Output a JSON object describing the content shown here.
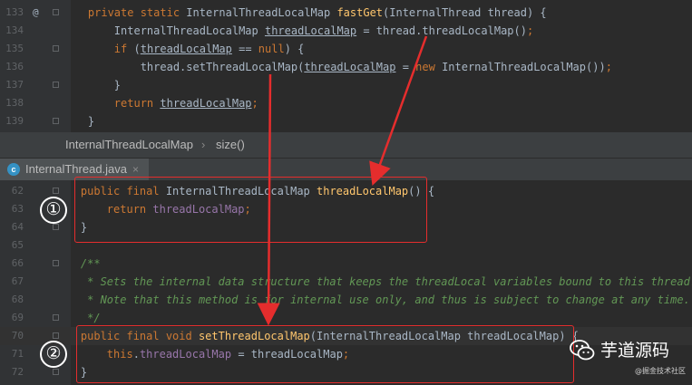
{
  "top_editor": {
    "lines": [
      {
        "num": "133",
        "at": "@",
        "segments": [
          {
            "t": "    ",
            "c": ""
          },
          {
            "t": "private static ",
            "c": "kw"
          },
          {
            "t": "InternalThreadLocalMap ",
            "c": ""
          },
          {
            "t": "fastGet",
            "c": "meth"
          },
          {
            "t": "(InternalThread thread) {",
            "c": ""
          }
        ]
      },
      {
        "num": "134",
        "segments": [
          {
            "t": "        InternalThreadLocalMap ",
            "c": ""
          },
          {
            "t": "threadLocalMap",
            "c": "ul"
          },
          {
            "t": " = thread.threadLocalMap()",
            "c": ""
          },
          {
            "t": ";",
            "c": "kw"
          }
        ]
      },
      {
        "num": "135",
        "segments": [
          {
            "t": "        ",
            "c": ""
          },
          {
            "t": "if ",
            "c": "kw"
          },
          {
            "t": "(",
            "c": ""
          },
          {
            "t": "threadLocalMap",
            "c": "ul"
          },
          {
            "t": " == ",
            "c": ""
          },
          {
            "t": "null",
            "c": "kw"
          },
          {
            "t": ") {",
            "c": ""
          }
        ]
      },
      {
        "num": "136",
        "segments": [
          {
            "t": "            thread.setThreadLocalMap(",
            "c": ""
          },
          {
            "t": "threadLocalMap",
            "c": "ul"
          },
          {
            "t": " = ",
            "c": ""
          },
          {
            "t": "new ",
            "c": "kw"
          },
          {
            "t": "InternalThreadLocalMap())",
            "c": ""
          },
          {
            "t": ";",
            "c": "kw"
          }
        ]
      },
      {
        "num": "137",
        "segments": [
          {
            "t": "        }",
            "c": ""
          }
        ]
      },
      {
        "num": "138",
        "segments": [
          {
            "t": "        ",
            "c": ""
          },
          {
            "t": "return ",
            "c": "kw"
          },
          {
            "t": "threadLocalMap",
            "c": "ul"
          },
          {
            "t": ";",
            "c": "kw"
          }
        ]
      },
      {
        "num": "139",
        "segments": [
          {
            "t": "    }",
            "c": ""
          }
        ]
      }
    ]
  },
  "breadcrumb": {
    "class_name": "InternalThreadLocalMap",
    "separator": "›",
    "method": "size()"
  },
  "tab": {
    "icon_letter": "c",
    "file_name": "InternalThread.java",
    "close": "×"
  },
  "bottom_editor": {
    "lines": [
      {
        "num": "62",
        "segments": [
          {
            "t": "    ",
            "c": ""
          },
          {
            "t": "public final ",
            "c": "kw"
          },
          {
            "t": "InternalThreadLocalMap ",
            "c": ""
          },
          {
            "t": "threadLocalMap",
            "c": "meth"
          },
          {
            "t": "() {",
            "c": ""
          }
        ]
      },
      {
        "num": "63",
        "segments": [
          {
            "t": "        ",
            "c": ""
          },
          {
            "t": "return ",
            "c": "kw"
          },
          {
            "t": "threadLocalMap",
            "c": "fld"
          },
          {
            "t": ";",
            "c": "kw"
          }
        ]
      },
      {
        "num": "64",
        "segments": [
          {
            "t": "    }",
            "c": ""
          }
        ]
      },
      {
        "num": "65",
        "segments": [
          {
            "t": "",
            "c": ""
          }
        ]
      },
      {
        "num": "66",
        "segments": [
          {
            "t": "    /**",
            "c": "com"
          }
        ]
      },
      {
        "num": "67",
        "segments": [
          {
            "t": "     * Sets the internal data structure that keeps the threadLocal variables bound to this thread.",
            "c": "com"
          }
        ]
      },
      {
        "num": "68",
        "segments": [
          {
            "t": "     * Note that this method is for internal use only, and thus is subject to change at any time.",
            "c": "com"
          }
        ]
      },
      {
        "num": "69",
        "segments": [
          {
            "t": "     */",
            "c": "com"
          }
        ]
      },
      {
        "num": "70",
        "highlight": true,
        "segments": [
          {
            "t": "    ",
            "c": ""
          },
          {
            "t": "public final void ",
            "c": "kw"
          },
          {
            "t": "setThreadLocalMap",
            "c": "meth"
          },
          {
            "t": "(InternalThreadLocalMap threadLocalMap) {",
            "c": ""
          }
        ]
      },
      {
        "num": "71",
        "segments": [
          {
            "t": "        ",
            "c": ""
          },
          {
            "t": "this",
            "c": "kw"
          },
          {
            "t": ".",
            "c": ""
          },
          {
            "t": "threadLocalMap",
            "c": "fld"
          },
          {
            "t": " = threadLocalMap",
            "c": ""
          },
          {
            "t": ";",
            "c": "kw"
          }
        ]
      },
      {
        "num": "72",
        "segments": [
          {
            "t": "    }",
            "c": ""
          }
        ]
      }
    ]
  },
  "annotations": {
    "marker_1": "①",
    "marker_2": "②",
    "accent": "#e52d2d"
  },
  "watermark": {
    "title": "芋道源码",
    "subtitle": "@掘金技术社区"
  },
  "colors": {
    "background": "#2b2b2b",
    "keyword": "#cc7832",
    "method": "#ffc66d",
    "field": "#9876aa",
    "comment": "#629755",
    "text": "#a9b7c6"
  }
}
